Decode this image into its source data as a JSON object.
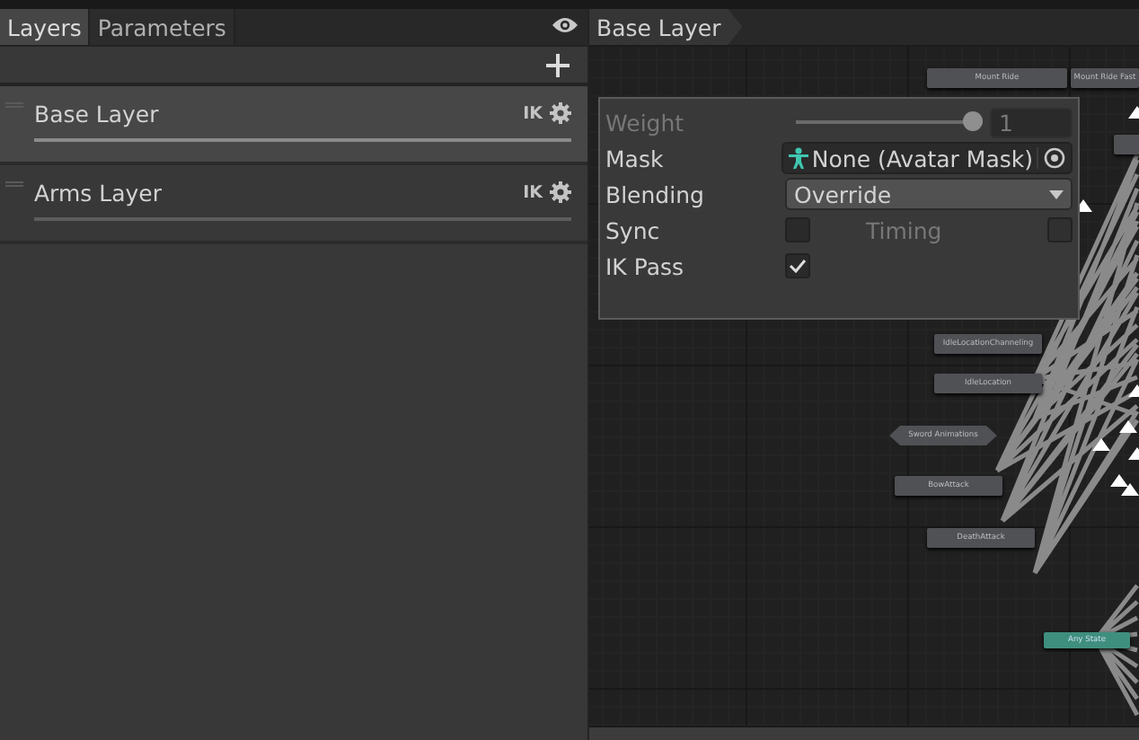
{
  "tabs": [
    {
      "label": "Layers",
      "selected": true
    },
    {
      "label": "Parameters",
      "selected": false
    }
  ],
  "layers": [
    {
      "name": "Base Layer",
      "ik": "IK",
      "selected": true
    },
    {
      "name": "Arms Layer",
      "ik": "IK",
      "selected": false
    }
  ],
  "breadcrumb": "Base Layer",
  "layer_settings": {
    "weight": {
      "label": "Weight",
      "disabled": true,
      "level": 1,
      "value": "1"
    },
    "mask": {
      "label": "Mask",
      "value": "None (Avatar Mask)"
    },
    "blending": {
      "label": "Blending",
      "value": "Override"
    },
    "sync": {
      "label": "Sync",
      "checked": false
    },
    "timing": {
      "label": "Timing",
      "disabled": true,
      "checked": false
    },
    "ik_pass": {
      "label": "IK Pass",
      "checked": true
    }
  },
  "nodes": [
    {
      "label": "Mount Ride",
      "kind": "state"
    },
    {
      "label": "Mount Ride Fast",
      "kind": "state"
    },
    {
      "kind": "state"
    },
    {
      "label": "IdleLocationChanneling",
      "kind": "state"
    },
    {
      "label": "IdleLocation",
      "kind": "state"
    },
    {
      "label": "Sword Animations",
      "kind": "machine"
    },
    {
      "label": "BowAttack",
      "kind": "state"
    },
    {
      "label": "DeathAttack",
      "kind": "state"
    },
    {
      "label": "Any State",
      "kind": "any"
    }
  ]
}
